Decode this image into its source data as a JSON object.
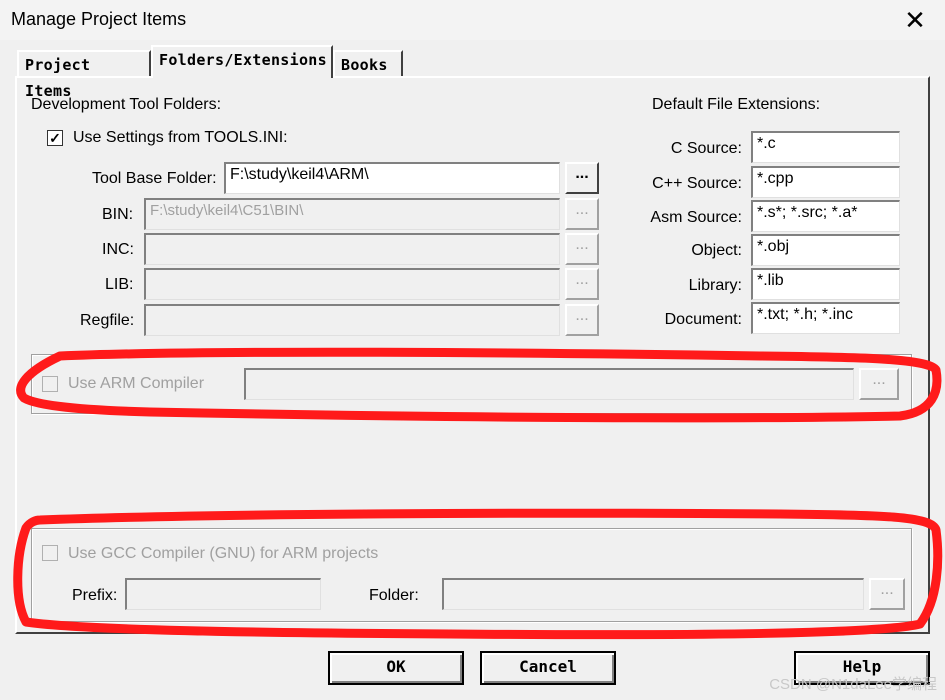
{
  "window": {
    "title": "Manage Project Items",
    "close_label": "✕"
  },
  "tabs": [
    {
      "label": "Project Items",
      "active": false
    },
    {
      "label": "Folders/Extensions",
      "active": true
    },
    {
      "label": "Books",
      "active": false
    }
  ],
  "folders": {
    "section_label": "Development Tool Folders:",
    "use_settings_label": "Use Settings from TOOLS.INI:",
    "use_settings_checked": true,
    "tool_base_label": "Tool Base Folder:",
    "tool_base_value": "F:\\study\\keil4\\ARM\\",
    "bin_label": "BIN:",
    "bin_value": "F:\\study\\keil4\\C51\\BIN\\",
    "inc_label": "INC:",
    "inc_value": "",
    "lib_label": "LIB:",
    "lib_value": "",
    "regfile_label": "Regfile:",
    "regfile_value": "",
    "browse_label": "..."
  },
  "extensions": {
    "section_label": "Default File Extensions:",
    "rows": [
      {
        "label": "C Source:",
        "value": "*.c"
      },
      {
        "label": "C++ Source:",
        "value": "*.cpp"
      },
      {
        "label": "Asm Source:",
        "value": "*.s*; *.src; *.a*"
      },
      {
        "label": "Object:",
        "value": "*.obj"
      },
      {
        "label": "Library:",
        "value": "*.lib"
      },
      {
        "label": "Document:",
        "value": "*.txt; *.h; *.inc"
      }
    ]
  },
  "arm": {
    "label": "Use ARM Compiler",
    "checked": false,
    "value": "",
    "browse_label": "..."
  },
  "gcc": {
    "label": "Use GCC Compiler (GNU) for ARM projects",
    "checked": false,
    "prefix_label": "Prefix:",
    "prefix_value": "",
    "folder_label": "Folder:",
    "folder_value": "",
    "browse_label": "..."
  },
  "buttons": {
    "ok": "OK",
    "cancel": "Cancel",
    "help": "Help"
  },
  "watermark": "CSDN @N1daLee学编程",
  "colors": {
    "annotation": "#ff1a1a",
    "window_bg": "#f0f0f0"
  }
}
